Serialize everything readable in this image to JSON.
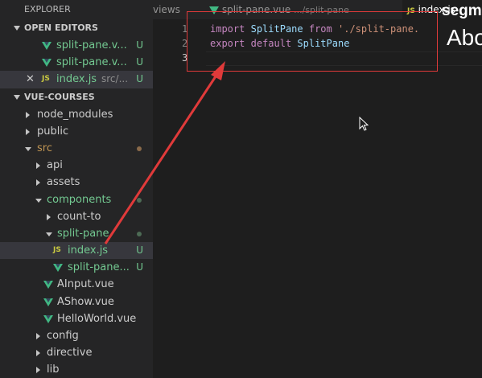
{
  "sidebar": {
    "header": "EXPLORER",
    "open_editors_title": "OPEN EDITORS",
    "open_editors": [
      {
        "label": "split-pane.v...",
        "status": "U",
        "icon": "vue-icon"
      },
      {
        "label": "split-pane.v...",
        "status": "U",
        "icon": "vue-icon"
      },
      {
        "label": "index.js",
        "path": "src/...",
        "status": "U",
        "icon": "js-icon"
      }
    ],
    "project_title": "VUE-COURSES",
    "tree": [
      {
        "label": "node_modules",
        "type": "folder"
      },
      {
        "label": "public",
        "type": "folder"
      },
      {
        "label": "src",
        "type": "folder-open"
      },
      {
        "label": "api",
        "type": "folder"
      },
      {
        "label": "assets",
        "type": "folder"
      },
      {
        "label": "components",
        "type": "folder-open"
      },
      {
        "label": "count-to",
        "type": "folder"
      },
      {
        "label": "split-pane",
        "type": "folder-open"
      },
      {
        "label": "index.js",
        "type": "js",
        "status": "U"
      },
      {
        "label": "split-pane...",
        "type": "vue",
        "status": "U"
      },
      {
        "label": "AInput.vue",
        "type": "vue"
      },
      {
        "label": "AShow.vue",
        "type": "vue"
      },
      {
        "label": "HelloWorld.vue",
        "type": "vue"
      },
      {
        "label": "config",
        "type": "folder"
      },
      {
        "label": "directive",
        "type": "folder"
      },
      {
        "label": "lib",
        "type": "folder"
      }
    ]
  },
  "tabs": {
    "tab1": "views",
    "tab2_name": "split-pane.vue",
    "tab2_path": ".../split-pane",
    "tab3_icon": "JS",
    "tab3_name": "index.js"
  },
  "editor": {
    "line_numbers": [
      "1",
      "2",
      "3"
    ],
    "line1": {
      "kw": "import",
      "id": "SplitPane",
      "from": "from",
      "str": "'./split-pane."
    },
    "line2": {
      "kw": "export",
      "kw2": "default",
      "id": "SplitPane"
    }
  },
  "overlay": {
    "right_text_1": "segm",
    "right_text_2": "Abo"
  },
  "colors": {
    "annotation": "#e03a3a",
    "untracked": "#73c991",
    "vue": "#41b883"
  }
}
